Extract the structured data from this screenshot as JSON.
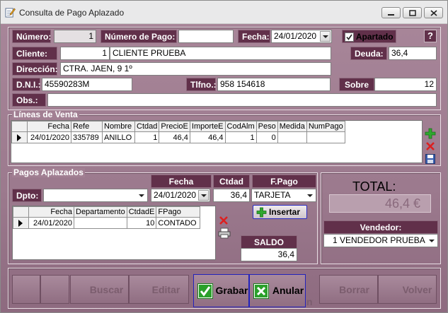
{
  "window": {
    "title": "Consulta de Pago Aplazado"
  },
  "header": {
    "numero_label": "Número:",
    "numero_value": "1",
    "numero_pago_label": "Número de Pago:",
    "numero_pago_value": "",
    "fecha_label": "Fecha:",
    "fecha_value": "24/01/2020",
    "apartado_label": "Apartado",
    "apartado_checked": true,
    "help_label": "?",
    "cliente_label": "Cliente:",
    "cliente_code": "1",
    "cliente_name": "CLIENTE PRUEBA",
    "deuda_label": "Deuda:",
    "deuda_value": "36,4",
    "direccion_label": "Dirección:",
    "direccion_value": "CTRA. JAEN, 9 1º",
    "dni_label": "D.N.I.:",
    "dni_value": "45590283M",
    "tlfno_label": "Tlfno.:",
    "tlfno_value": "958 154618",
    "sobre_label": "Sobre",
    "sobre_value": "12",
    "obs_label": "Obs.:",
    "obs_value": ""
  },
  "lineas": {
    "title": "Líneas de Venta",
    "columns": [
      "Fecha",
      "Refe",
      "Nombre",
      "Ctdad",
      "PrecioE",
      "ImporteE",
      "CodAlm",
      "Peso",
      "Medida",
      "NumPago"
    ],
    "rows": [
      [
        "24/01/2020",
        "335789",
        "ANILLO",
        "1",
        "46,4",
        "46,4",
        "1",
        "0",
        "",
        ""
      ]
    ]
  },
  "pagos": {
    "title": "Pagos Aplazados",
    "fecha_label": "Fecha",
    "ctdad_label": "Ctdad",
    "fpago_label": "F.Pago",
    "dpto_label": "Dpto:",
    "dpto_value": "",
    "fecha_value": "24/01/2020",
    "ctdad_value": "36,4",
    "fpago_value": "TARJETA",
    "insertar_label": "Insertar",
    "columns": [
      "Fecha",
      "Departamento",
      "CtdadE",
      "FPago"
    ],
    "rows": [
      [
        "24/01/2020",
        "",
        "10",
        "CONTADO"
      ]
    ],
    "saldo_label": "SALDO",
    "saldo_value": "36,4"
  },
  "total": {
    "label": "TOTAL:",
    "value": "46,4 €",
    "vendedor_label": "Vendedor:",
    "vendedor_value": "1 VENDEDOR PRUEBA"
  },
  "toolbar": {
    "buscar": "Buscar",
    "editar": "Editar",
    "grabar": "Grabar",
    "anular": "Anular",
    "borrar": "Borrar",
    "volver": "Volver",
    "hidden_text": "n"
  },
  "colors": {
    "accent": "#61304a",
    "background": "#9c7a8e",
    "total_text": "#8a6a7d"
  }
}
